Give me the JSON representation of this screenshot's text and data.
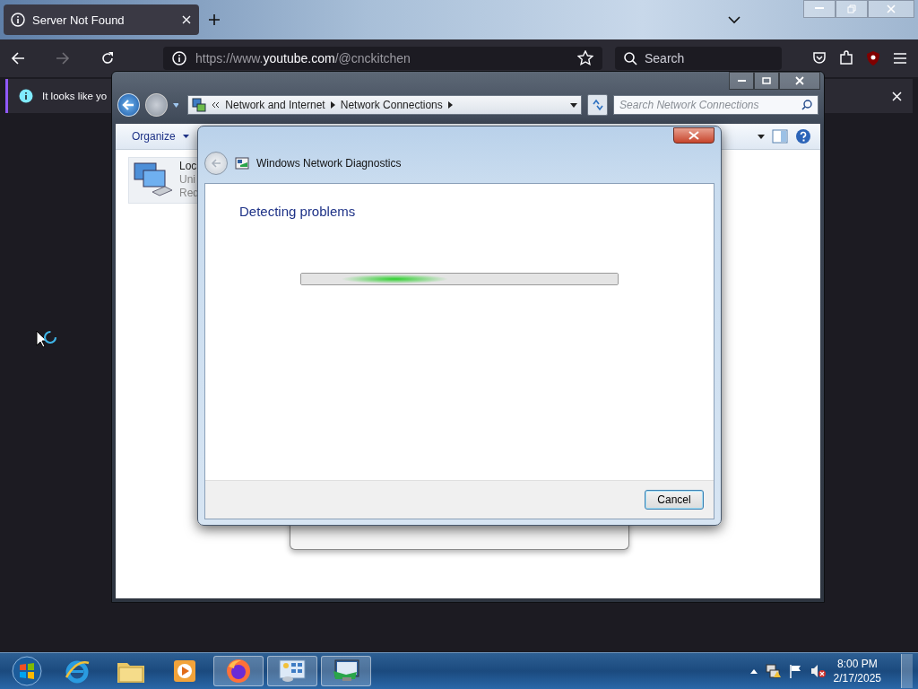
{
  "browser": {
    "tabs": [
      {
        "label": "Server Not Found",
        "selected": true
      }
    ],
    "url": {
      "prefix": "https://www.",
      "domain": "youtube.com",
      "path": "/@cnckitchen"
    },
    "search": {
      "placeholder": "Search"
    },
    "notification": "It looks like yo"
  },
  "explorer": {
    "breadcrumbs": [
      "Network and Internet",
      "Network Connections"
    ],
    "search": {
      "placeholder": "Search Network Connections"
    },
    "toolbar": [
      "Organize"
    ],
    "item_lines": [
      "Loc",
      "Uni",
      "Red"
    ]
  },
  "dialog": {
    "title": "Windows Network Diagnostics",
    "heading": "Detecting problems",
    "buttons": [
      "Cancel"
    ]
  },
  "taskbar": {
    "apps": [
      {
        "kind": "ie",
        "running": false
      },
      {
        "kind": "folder",
        "running": false
      },
      {
        "kind": "media",
        "running": false
      },
      {
        "kind": "firefox",
        "running": true
      },
      {
        "kind": "control",
        "running": true
      },
      {
        "kind": "network",
        "running": true
      }
    ],
    "time": "8:00 PM",
    "date": "2/17/2025"
  }
}
